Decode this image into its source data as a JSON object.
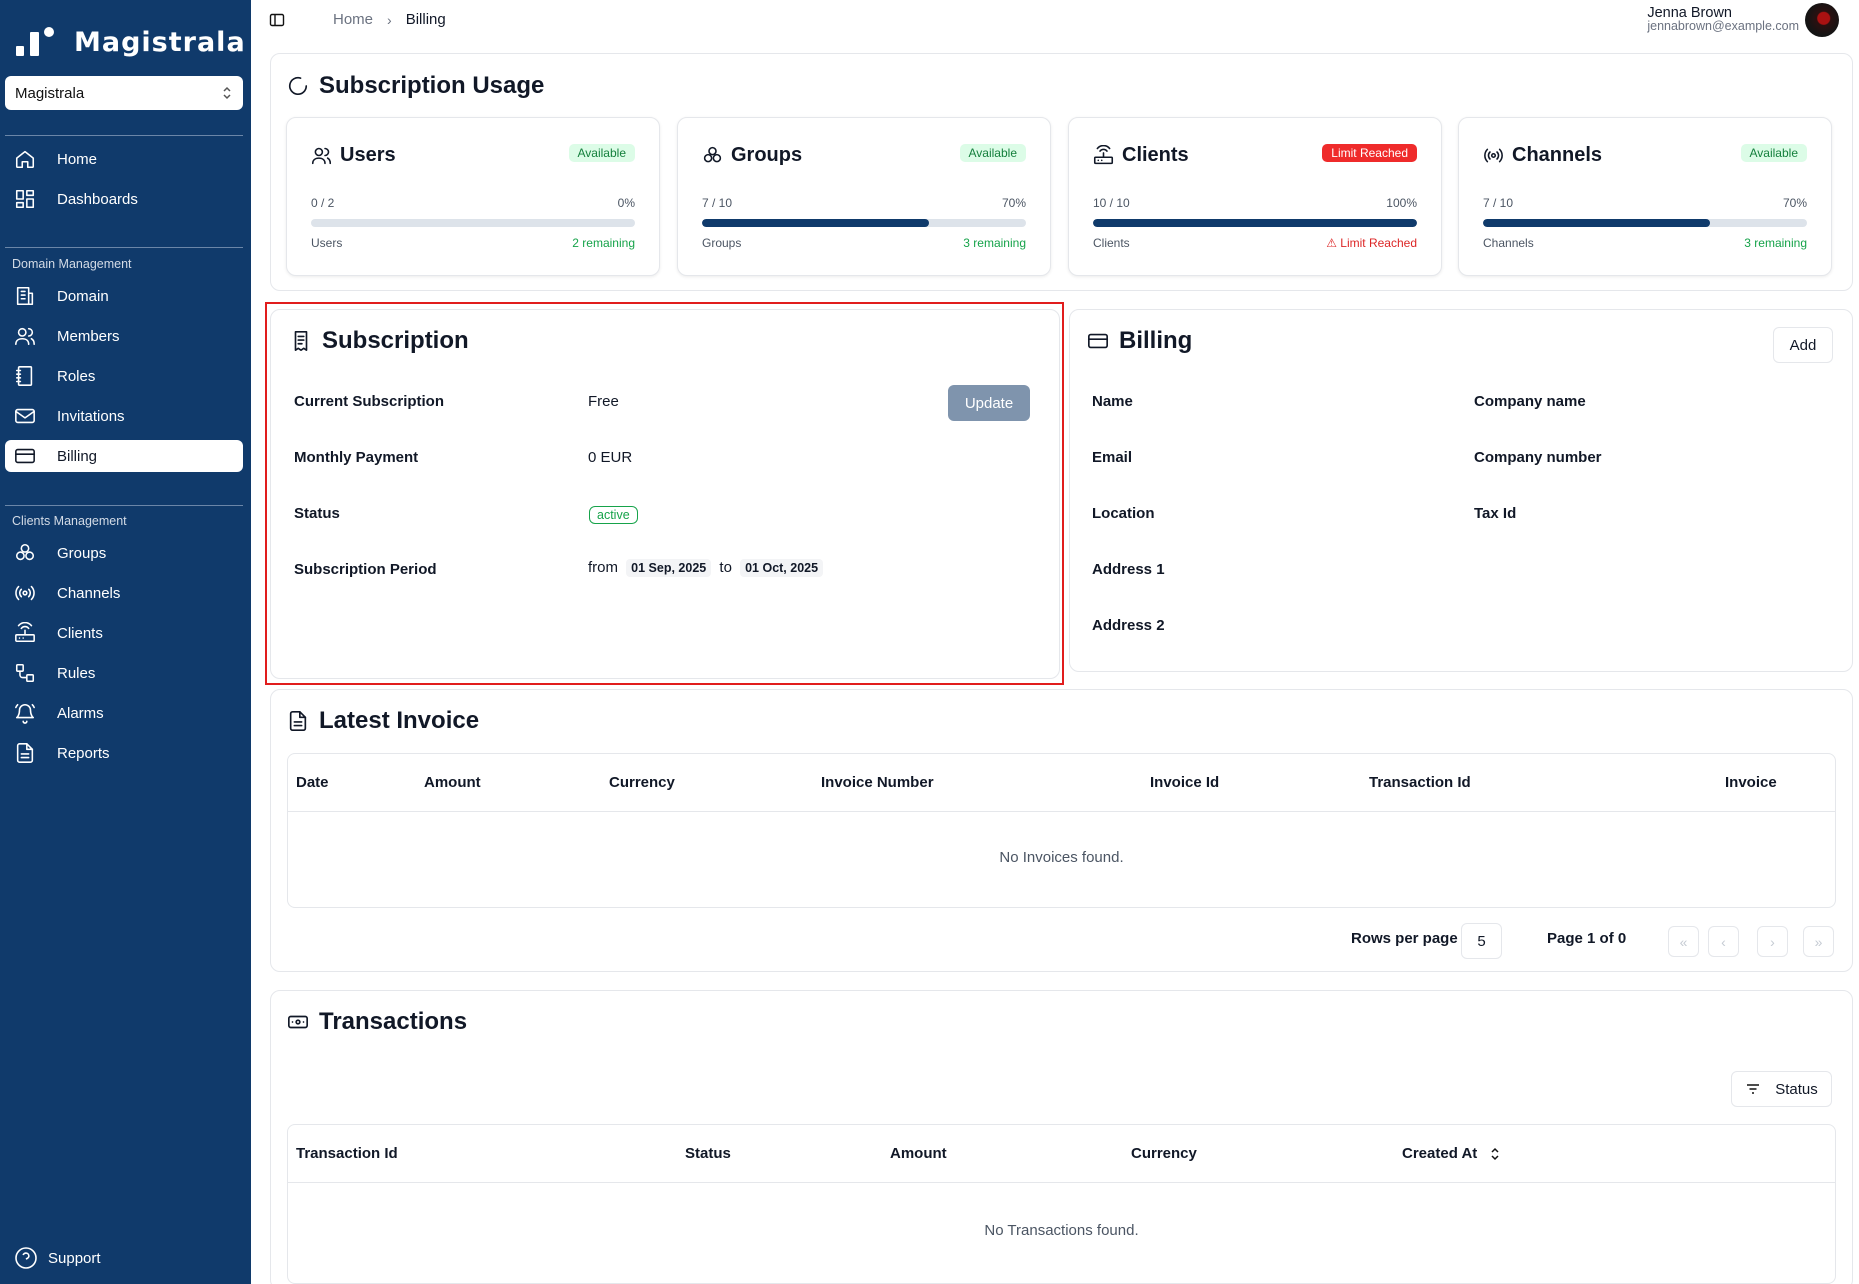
{
  "sidebar": {
    "brand": "Magistrala",
    "domain_select": "Magistrala",
    "top_items": [
      {
        "label": "Home",
        "icon": "home-icon"
      },
      {
        "label": "Dashboards",
        "icon": "dashboard-icon"
      }
    ],
    "domain_section": "Domain Management",
    "domain_items": [
      {
        "label": "Domain",
        "icon": "building-icon"
      },
      {
        "label": "Members",
        "icon": "users-icon"
      },
      {
        "label": "Roles",
        "icon": "notebook-icon"
      },
      {
        "label": "Invitations",
        "icon": "mail-icon"
      },
      {
        "label": "Billing",
        "icon": "credit-card-icon",
        "active": true
      }
    ],
    "clients_section": "Clients Management",
    "client_items": [
      {
        "label": "Groups",
        "icon": "groups-icon"
      },
      {
        "label": "Channels",
        "icon": "radio-icon"
      },
      {
        "label": "Clients",
        "icon": "router-icon"
      },
      {
        "label": "Rules",
        "icon": "rules-icon"
      },
      {
        "label": "Alarms",
        "icon": "bell-icon"
      },
      {
        "label": "Reports",
        "icon": "report-icon"
      }
    ],
    "support": "Support"
  },
  "header": {
    "breadcrumb": [
      "Home",
      "Billing"
    ],
    "user_name": "Jenna Brown",
    "user_email": "jennabrown@example.com"
  },
  "usage": {
    "title": "Subscription Usage",
    "cards": [
      {
        "title": "Users",
        "badge": "Available",
        "count": "0 / 2",
        "percent": "0%",
        "fill": 0,
        "label": "Users",
        "remaining": "2 remaining"
      },
      {
        "title": "Groups",
        "badge": "Available",
        "count": "7 / 10",
        "percent": "70%",
        "fill": 70,
        "label": "Groups",
        "remaining": "3 remaining"
      },
      {
        "title": "Clients",
        "badge": "Limit Reached",
        "count": "10 / 10",
        "percent": "100%",
        "fill": 100,
        "label": "Clients",
        "remaining": "Limit Reached"
      },
      {
        "title": "Channels",
        "badge": "Available",
        "count": "7 / 10",
        "percent": "70%",
        "fill": 70,
        "label": "Channels",
        "remaining": "3 remaining"
      }
    ]
  },
  "subscription": {
    "title": "Subscription",
    "current_label": "Current Subscription",
    "current_value": "Free",
    "update_button": "Update",
    "monthly_label": "Monthly Payment",
    "monthly_value": "0 EUR",
    "status_label": "Status",
    "status_value": "active",
    "period_label": "Subscription Period",
    "period_from": "from",
    "period_start": "01 Sep, 2025",
    "period_to": "to",
    "period_end": "01 Oct, 2025"
  },
  "billing": {
    "title": "Billing",
    "add_button": "Add",
    "fields_left": [
      "Name",
      "Email",
      "Location",
      "Address 1",
      "Address 2"
    ],
    "fields_right": [
      "Company name",
      "Company number",
      "Tax Id"
    ]
  },
  "invoice": {
    "title": "Latest Invoice",
    "columns": [
      "Date",
      "Amount",
      "Currency",
      "Invoice Number",
      "Invoice Id",
      "Transaction Id",
      "Invoice"
    ],
    "empty": "No Invoices found.",
    "rows_per_page_label": "Rows per page",
    "rows_per_page": "5",
    "page_info": "Page 1 of 0"
  },
  "transactions": {
    "title": "Transactions",
    "filter_button": "Status",
    "columns": [
      "Transaction Id",
      "Status",
      "Amount",
      "Currency",
      "Created At"
    ],
    "empty": "No Transactions found."
  },
  "colors": {
    "sidebar": "#103a6b",
    "progress": "#0f3a6b",
    "available": "#15803d",
    "limit": "#ef2b2b",
    "highlight": "#e11d1d"
  }
}
